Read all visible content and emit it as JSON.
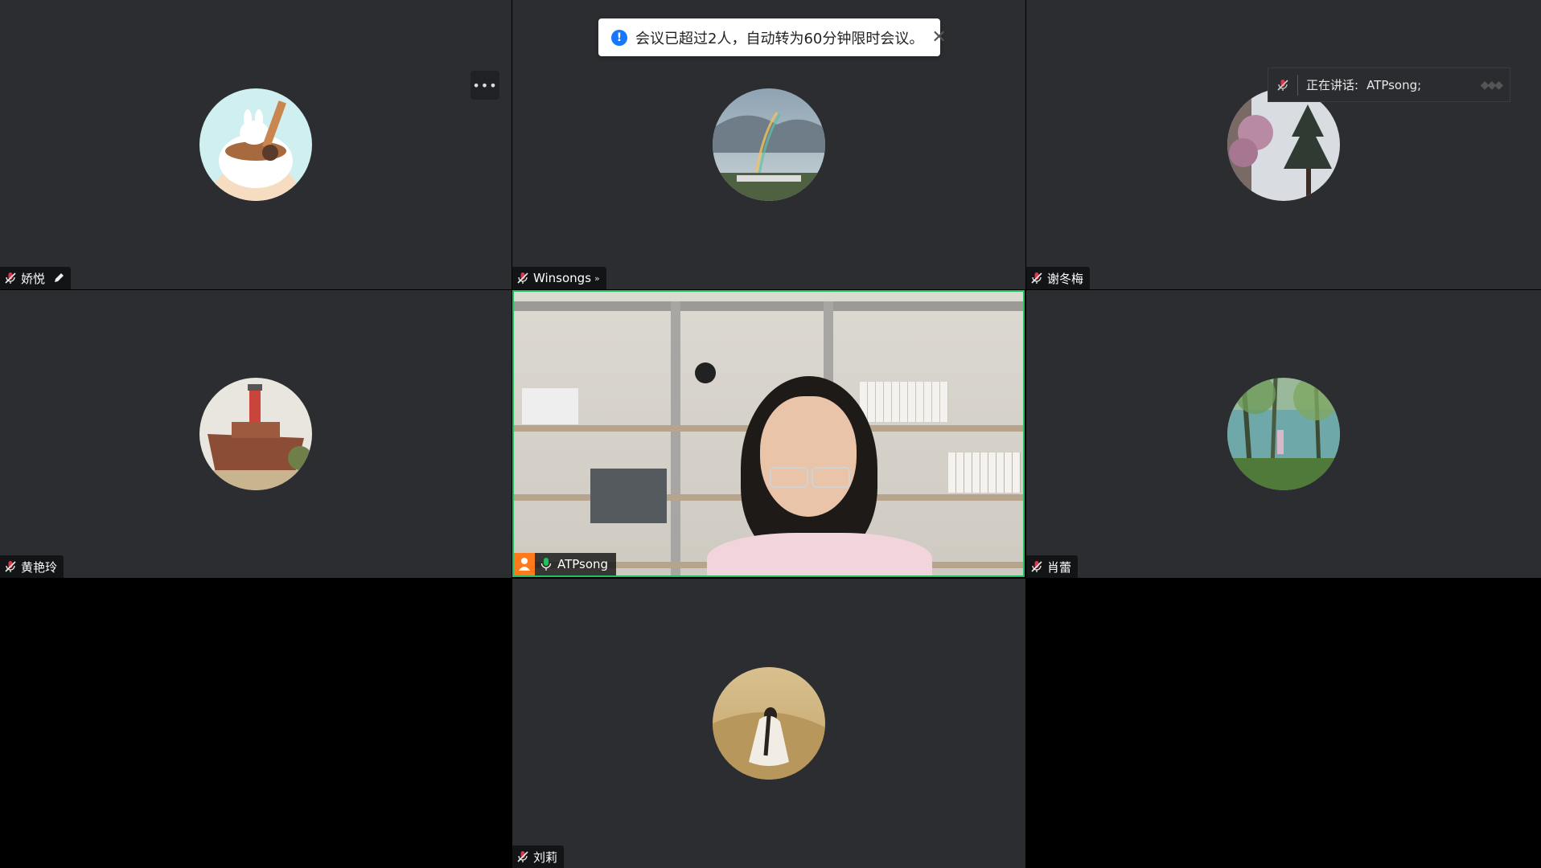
{
  "notification": {
    "message": "会议已超过2人，自动转为60分钟限时会议。",
    "icon": "info-icon",
    "close_icon": "close-icon"
  },
  "speaking_indicator": {
    "label": "正在讲话:",
    "speaker": "ATPsong;"
  },
  "participants": [
    {
      "name": "娇悦",
      "mic": "muted",
      "extra_icon": "pencil-icon"
    },
    {
      "name": "Winsongs",
      "mic": "muted",
      "extra_icon": "chevron-double-down-icon"
    },
    {
      "name": "谢冬梅",
      "mic": "muted"
    },
    {
      "name": "黄艳玲",
      "mic": "muted"
    },
    {
      "name": "ATPsong",
      "mic": "active",
      "video": true,
      "sharing_icon": "person-icon"
    },
    {
      "name": "肖蕾",
      "mic": "muted"
    },
    {
      "name": "刘莉",
      "mic": "muted"
    }
  ],
  "colors": {
    "tile_bg": "#2b2d31",
    "active_border": "#21c05a",
    "muted_mic": "#e0344a",
    "active_mic": "#21c05a",
    "info_blue": "#1677ff"
  }
}
